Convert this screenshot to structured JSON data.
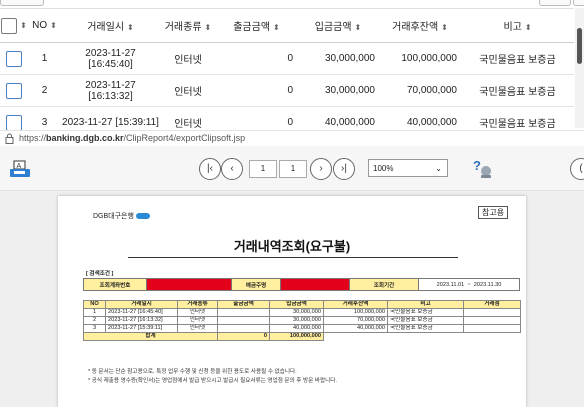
{
  "grid": {
    "headers": {
      "no": "NO",
      "date": "거래일시",
      "type": "거래종류",
      "withdraw": "출금금액",
      "deposit": "입금금액",
      "balance": "거래후잔액",
      "memo": "비고"
    },
    "rows": [
      {
        "no": "1",
        "date": "2023-11-27 [16:45:40]",
        "type": "인터넷",
        "withdraw": "0",
        "deposit": "30,000,000",
        "balance": "100,000,000",
        "memo": "국민물음표 보증금"
      },
      {
        "no": "2",
        "date": "2023-11-27 [16:13:32]",
        "type": "인터넷",
        "withdraw": "0",
        "deposit": "30,000,000",
        "balance": "70,000,000",
        "memo": "국민물음표 보증금"
      },
      {
        "no": "3",
        "date": "2023-11-27 [15:39:11]",
        "type": "인터넷",
        "withdraw": "0",
        "deposit": "40,000,000",
        "balance": "40,000,000",
        "memo": "국민물음표 보증금"
      }
    ]
  },
  "status": {
    "url_prefix": "https://",
    "url_host": "banking.dgb.co.kr",
    "url_path": "/ClipReport4/exportClipsoft.jsp"
  },
  "viewer": {
    "page_current": "1",
    "page_total": "1",
    "zoom": "100%",
    "icons": [
      "print-icon",
      "first-page-icon",
      "prev-page-icon",
      "next-page-icon",
      "last-page-icon",
      "help-icon"
    ]
  },
  "doc": {
    "bank_name": "DGB대구은행",
    "ref_label": "참고용",
    "title": "거래내역조회(요구불)",
    "cond_title": "[ 검색조건 ]",
    "cond": {
      "account_label": "조회계좌번호",
      "holder_label": "예금주명",
      "period_label": "조회기간",
      "period_from": "2023.11.01",
      "period_sep": "~",
      "period_to": "2023.11.30"
    },
    "table_headers": [
      "NO",
      "거래일시",
      "거래종류",
      "출금금액",
      "입금금액",
      "거래후잔액",
      "비고",
      "거래점"
    ],
    "rows": [
      [
        "1",
        "2023-11-27 [16:45:40]",
        "인터넷",
        "",
        "30,000,000",
        "100,000,000",
        "국민물음표 보증금",
        ""
      ],
      [
        "2",
        "2023-11-27 [16:13:32]",
        "인터넷",
        "",
        "30,000,000",
        "70,000,000",
        "국민물음표 보증금",
        ""
      ],
      [
        "3",
        "2023-11-27 [15:39:11]",
        "인터넷",
        "",
        "40,000,000",
        "40,000,000",
        "국민물음표 보증금",
        ""
      ]
    ],
    "total_label": "합계",
    "total_withdraw": "0",
    "total_deposit": "100,000,000",
    "notes": [
      "* 동 문서는 단순 참고용으로, 특정 업무 수행 및 신청 등을 위한 용도로 사용될 수 없습니다.",
      "* 공식 제출용 영수증(확인서)는 영업점에서 발급 받으시고 발급시 필요서류는 영업점 문의 후 방문 바랍니다."
    ]
  },
  "colors": {
    "redact": "#e3001b",
    "header_yellow": "#ffef9f",
    "accent_blue": "#4a7fc1"
  }
}
